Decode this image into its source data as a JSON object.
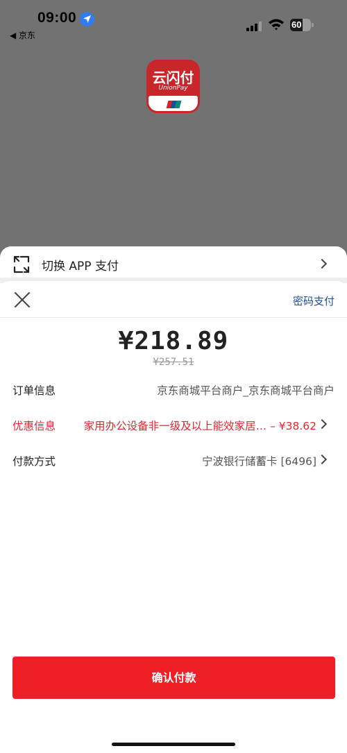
{
  "status_bar": {
    "time": "09:00",
    "back_app": "◀ 京东",
    "battery": "60"
  },
  "unionpay": {
    "name_cn": "云闪付",
    "name_en": "UnionPay",
    "colors": {
      "red": "#c9262c",
      "stripe_red": "#d6232b",
      "stripe_blue": "#1a4f9a",
      "stripe_green": "#0a8a7f"
    }
  },
  "switch_app": {
    "label": "切换 APP 支付"
  },
  "payment": {
    "password_pay": "密码支付",
    "amount": "¥218.89",
    "original_amount": "¥257.51",
    "rows": [
      {
        "label": "订单信息",
        "value": "京东商城平台商户_京东商城平台商户"
      },
      {
        "label": "优惠信息",
        "value": "家用办公设备非一级及以上能效家居… – ¥38.62"
      },
      {
        "label": "付款方式",
        "value": "宁波银行储蓄卡 [6496]"
      }
    ],
    "confirm_label": "确认付款"
  },
  "colors": {
    "accent_red": "#ee1f26",
    "link_blue": "#1f4f9a",
    "overlay": "#727272"
  }
}
